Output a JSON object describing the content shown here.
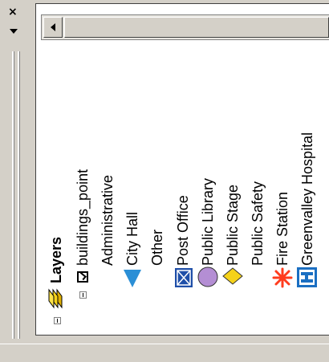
{
  "toc": {
    "root_label": "Layers",
    "layer_name": "buildings_point",
    "categories": [
      {
        "label": "Administrative",
        "symbol": "none",
        "color": ""
      },
      {
        "label": "City Hall",
        "symbol": "triangle-icon",
        "color": "#2b8fd6"
      },
      {
        "label": "Other",
        "symbol": "none",
        "color": ""
      },
      {
        "label": "Post Office",
        "symbol": "post-office-icon",
        "color": "#1f4fa8"
      },
      {
        "label": "Public Library",
        "symbol": "circle-icon",
        "color": "#b48ed4"
      },
      {
        "label": "Public Stage",
        "symbol": "diamond-icon",
        "color": "#f5d21a"
      },
      {
        "label": "Public Safety",
        "symbol": "none",
        "color": ""
      },
      {
        "label": "Fire Station",
        "symbol": "asterisk-icon",
        "color": "#ff3c1e"
      },
      {
        "label": "Greenvalley Hospital",
        "symbol": "hospital-icon",
        "color": "#1b6fc2"
      }
    ]
  },
  "window": {
    "close_glyph": "×"
  }
}
